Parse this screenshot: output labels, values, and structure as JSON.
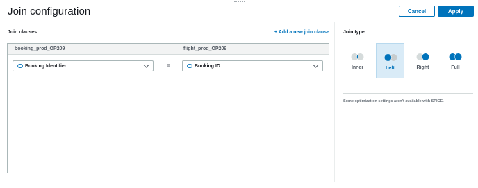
{
  "header": {
    "title": "Join configuration",
    "cancel_label": "Cancel",
    "apply_label": "Apply"
  },
  "clauses": {
    "section_label": "Join clauses",
    "add_label": "+ Add a new join clause",
    "left_table": "booking_prod_OP209",
    "right_table": "flight_prod_OP209",
    "left_field": "Booking Identifier",
    "right_field": "Booking ID",
    "operator": "="
  },
  "join_type": {
    "section_label": "Join type",
    "selected": "Left",
    "options": [
      {
        "label": "Inner",
        "icon": "inner-join-icon"
      },
      {
        "label": "Left",
        "icon": "left-join-icon"
      },
      {
        "label": "Right",
        "icon": "right-join-icon"
      },
      {
        "label": "Full",
        "icon": "full-join-icon"
      }
    ],
    "note": "Some optimization settings aren't available with SPICE."
  },
  "colors": {
    "accent": "#0073bb",
    "selected_bg": "#d9ebf7",
    "inactive_circle": "#d5dbdb",
    "join_fill": "#0073bb"
  }
}
